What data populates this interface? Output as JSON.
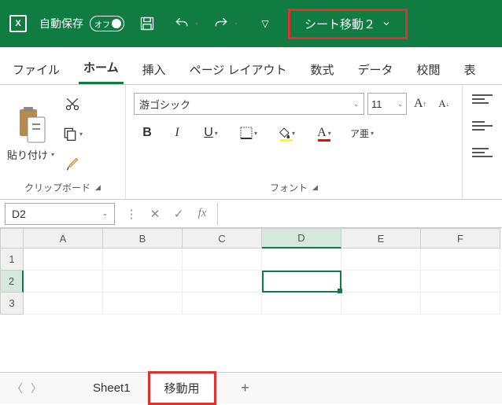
{
  "titlebar": {
    "autosave_label": "自動保存",
    "autosave_state": "オフ",
    "macro_name": "シート移動２"
  },
  "tabs": {
    "file": "ファイル",
    "home": "ホーム",
    "insert": "挿入",
    "page_layout": "ページ レイアウト",
    "formulas": "数式",
    "data": "データ",
    "review": "校閲",
    "view": "表"
  },
  "ribbon": {
    "clipboard": {
      "paste": "貼り付け",
      "group_label": "クリップボード"
    },
    "font": {
      "name": "游ゴシック",
      "size": "11",
      "group_label": "フォント",
      "ruby": "ア亜"
    }
  },
  "formula_bar": {
    "name_box": "D2",
    "fx": "fx"
  },
  "grid": {
    "cols": [
      "A",
      "B",
      "C",
      "D",
      "E",
      "F"
    ],
    "rows": [
      "1",
      "2",
      "3"
    ],
    "active_col": "D",
    "active_row": "2"
  },
  "sheet_tabs": {
    "sheets": [
      "Sheet1",
      "移動用"
    ],
    "active": "移動用",
    "add": "+"
  }
}
